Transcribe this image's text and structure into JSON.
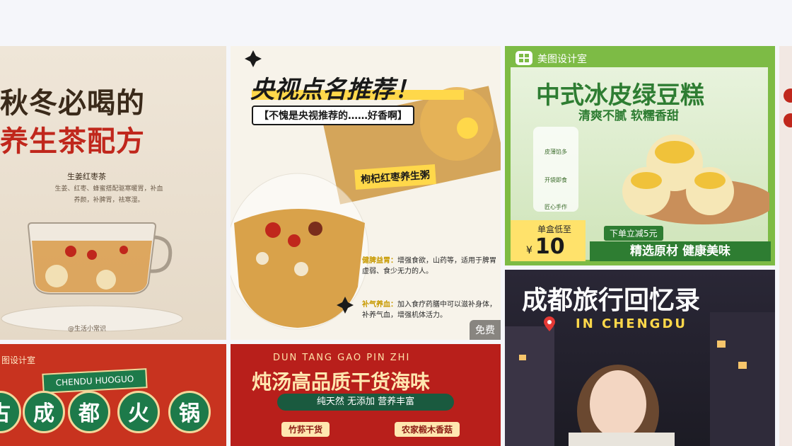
{
  "cards": [
    {
      "title_line1": "秋冬必喝的",
      "title_line2": "养生茶配方",
      "recipe_name": "生姜红枣茶",
      "ingredients_line1": "生姜、红枣、蜂蜜搭配驱寒暖胃，补血",
      "ingredients_line2": "养颜，补脾胃，祛寒湿。",
      "credit": "@生活小常识"
    },
    {
      "title": "央视点名推荐！",
      "bubble": "【不愧是央视推荐的……好香啊】",
      "tag": "枸杞红枣养生粥",
      "note1_key": "健脾益胃：",
      "note1_text": "增强食欲，山药等，适用于脾胃虚弱、食少无力的人。",
      "note2_key": "补气养血：",
      "note2_text": "加入食疗药膳中可以滋补身体，补养气血，增强机体活力。",
      "badge": "免费"
    },
    {
      "brand": "美图设计室",
      "title": "中式冰皮绿豆糕",
      "subtitle": "清爽不腻 软糯香甜",
      "features": [
        "皮薄馅多",
        "开袋即食",
        "匠心手作"
      ],
      "price_label": "单盒低至",
      "currency": "¥",
      "price": "10",
      "discount": "下单立减5元",
      "quality": "精选原材 健康美味"
    },
    {
      "title": "成都旅行回忆录",
      "subtitle": "IN CHENGDU"
    },
    {
      "brand": "图设计室",
      "banner": "CHENDU HUOGUO",
      "chars": [
        "古",
        "成",
        "都",
        "火",
        "锅"
      ]
    },
    {
      "pinyin": "DUN TANG GAO PIN ZHI",
      "title": "炖汤高品质干货海味",
      "ribbon": "纯天然 无添加 营养丰富",
      "cat1": "竹荪干货",
      "cat2": "农家椴木香菇"
    }
  ],
  "colors": {
    "tea_red": "#c0271c",
    "green": "#2e7d32",
    "yellow": "#ffd84a",
    "hotpot_red": "#c8331f"
  }
}
